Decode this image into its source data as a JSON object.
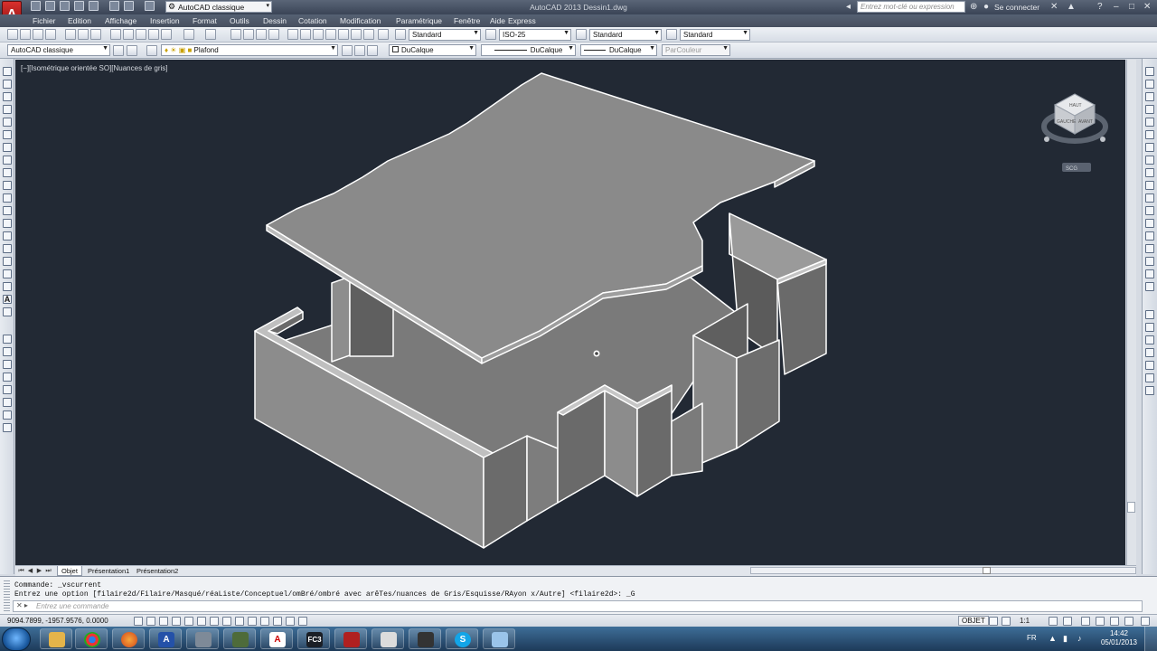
{
  "titlebar": {
    "title": "AutoCAD 2013    Dessin1.dwg",
    "workspace": "AutoCAD classique",
    "search_placeholder": "Entrez mot-clé ou expression",
    "signin": "Se connecter"
  },
  "menu": [
    "Fichier",
    "Edition",
    "Affichage",
    "Insertion",
    "Format",
    "Outils",
    "Dessin",
    "Cotation",
    "Modification",
    "Paramétrique",
    "Fenêtre",
    "Aide",
    "Express"
  ],
  "toolbar1": {
    "text_style": "Standard",
    "dim_style": "ISO-25",
    "table_style": "Standard",
    "mleader_style": "Standard"
  },
  "toolbar2": {
    "workspace": "AutoCAD classique",
    "layer": "Plafond",
    "color": "DuCalque",
    "linetype": "DuCalque",
    "lineweight": "DuCalque",
    "plotstyle": "ParCouleur"
  },
  "viewport": {
    "label": "[−][Isométrique orientée SO][Nuances de gris]",
    "viewcube_faces": [
      "HAUT",
      "GAUCHE",
      "AVANT"
    ],
    "wcs_label": "SCG"
  },
  "layout_tabs": [
    "Objet",
    "Présentation1",
    "Présentation2"
  ],
  "command": {
    "history": [
      "Commande: _vscurrent",
      "Entrez une option [filaire2d/Filaire/Masqué/réaListe/Conceptuel/omBré/ombré avec arêTes/nuances de Gris/Esquisse/RAyon x/Autre] <filaire2d>: _G"
    ],
    "input_placeholder": "Entrez une commande"
  },
  "status": {
    "coordinates": "9094.7899, -1957.9576, 0.0000",
    "model": "OBJET",
    "annotation_scale": "1:1"
  },
  "taskbar": {
    "apps": [
      "explorer",
      "chrome",
      "firefox",
      "autocad",
      "vlc",
      "revit",
      "autodesk",
      "fc3",
      "virtualbox",
      "calculator",
      "misc",
      "skype",
      "windows"
    ],
    "language": "FR",
    "time": "14:42",
    "date": "05/01/2013"
  },
  "colors": {
    "viewport_bg": "#222934",
    "model_face_light": "#8a8a8a",
    "model_face_dark": "#5e5e5e",
    "model_edge": "#ffffff"
  }
}
